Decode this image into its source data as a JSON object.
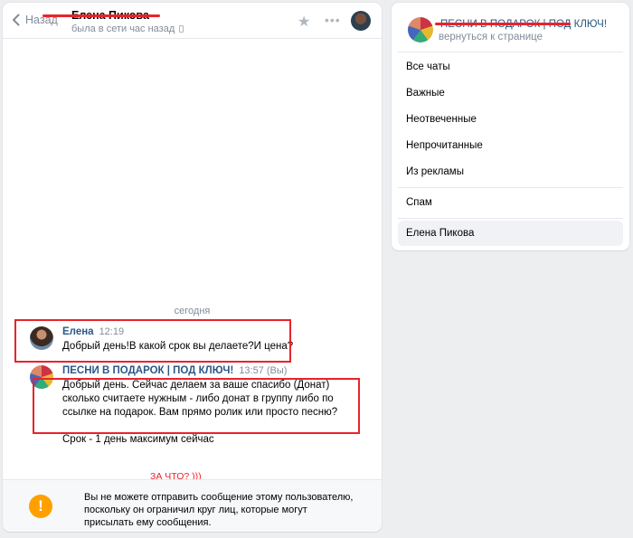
{
  "chat": {
    "back_label": "Назад",
    "peer_name": "Елена Пикова",
    "peer_status": "была в сети час назад",
    "date_separator": "сегодня",
    "messages": [
      {
        "author": "Елена",
        "time": "12:19",
        "lines": [
          "Добрый день!В какой срок вы делаете?И цена?"
        ]
      },
      {
        "author": "ПЕСНИ В ПОДАРОК | ПОД КЛЮЧ!",
        "time": "13:57 (Вы)",
        "lines": [
          "Добрый день. Сейчас делаем за ваше спасибо (Донат)",
          "сколько считаете нужным - либо донат в группу либо по",
          "ссылке на подарок. Вам прямо ролик или просто песню?",
          "",
          "Срок - 1 день максимум сейчас"
        ]
      }
    ],
    "annotation": "ЗА ЧТО? )))",
    "notice": {
      "icon": "!",
      "text": "Вы не можете отправить сообщение этому пользователю, поскольку он ограничил круг лиц, которые могут присылать ему сообщения."
    }
  },
  "sidebar": {
    "community_name": "ПЕСНИ В ПОДАРОК | ПОД КЛЮЧ!",
    "back_link": "вернуться к странице",
    "items": [
      {
        "label": "Все чаты"
      },
      {
        "label": "Важные"
      },
      {
        "label": "Неотвеченные"
      },
      {
        "label": "Непрочитанные"
      },
      {
        "label": "Из рекламы"
      },
      {
        "label": "Спам"
      },
      {
        "label": "Елена Пикова"
      }
    ]
  },
  "colors": {
    "accent": "#2a5885",
    "annotation_red": "#e8232b",
    "warning": "#ffa000"
  }
}
